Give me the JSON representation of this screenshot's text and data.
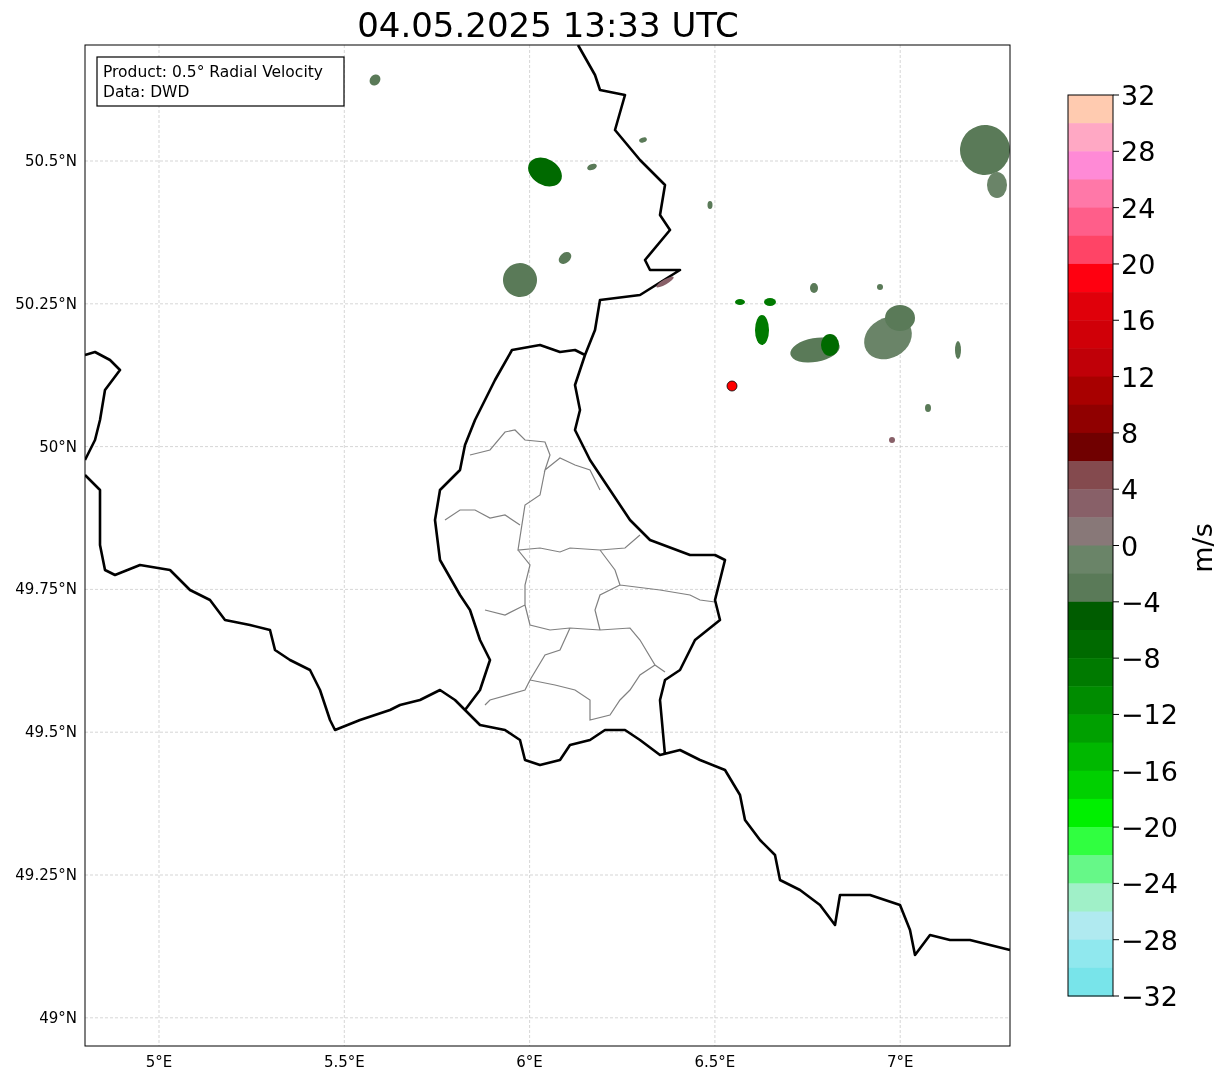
{
  "title": "04.05.2025 13:33 UTC",
  "info_box": {
    "lines": [
      "Product: 0.5° Radial Velocity",
      "Data: DWD"
    ]
  },
  "map": {
    "lat_labels": [
      "50.5°N",
      "50.25°N",
      "50°N",
      "49.75°N",
      "49.5°N",
      "49.25°N",
      "49°N"
    ],
    "lon_labels": [
      "5°E",
      "5.5°E",
      "6°E",
      "6.5°E",
      "7°E"
    ]
  },
  "colorbar": {
    "label": "m/s",
    "ticks": [
      "32",
      "28",
      "24",
      "20",
      "16",
      "12",
      "8",
      "4",
      "0",
      "−4",
      "−8",
      "−12",
      "−16",
      "−20",
      "−24",
      "−28",
      "−32"
    ],
    "bins": [
      {
        "color": "#ffcbb0"
      },
      {
        "color": "#ffa8c4"
      },
      {
        "color": "#ff8ad6"
      },
      {
        "color": "#ff78a8"
      },
      {
        "color": "#ff5e8a"
      },
      {
        "color": "#ff4466"
      },
      {
        "color": "#ff0010"
      },
      {
        "color": "#e0000a"
      },
      {
        "color": "#d00008"
      },
      {
        "color": "#c00008"
      },
      {
        "color": "#a80000"
      },
      {
        "color": "#900000"
      },
      {
        "color": "#700000"
      },
      {
        "color": "#844a4e"
      },
      {
        "color": "#886068"
      },
      {
        "color": "#887878"
      },
      {
        "color": "#6a8468"
      },
      {
        "color": "#5a7a58"
      },
      {
        "color": "#005c00"
      },
      {
        "color": "#006a00"
      },
      {
        "color": "#007a00"
      },
      {
        "color": "#008c00"
      },
      {
        "color": "#00a000"
      },
      {
        "color": "#00b800"
      },
      {
        "color": "#00d000"
      },
      {
        "color": "#00f000"
      },
      {
        "color": "#30ff40"
      },
      {
        "color": "#66f888"
      },
      {
        "color": "#a0f0c8"
      },
      {
        "color": "#b0eaf0"
      },
      {
        "color": "#90e8ee"
      },
      {
        "color": "#78e4ea"
      }
    ]
  }
}
